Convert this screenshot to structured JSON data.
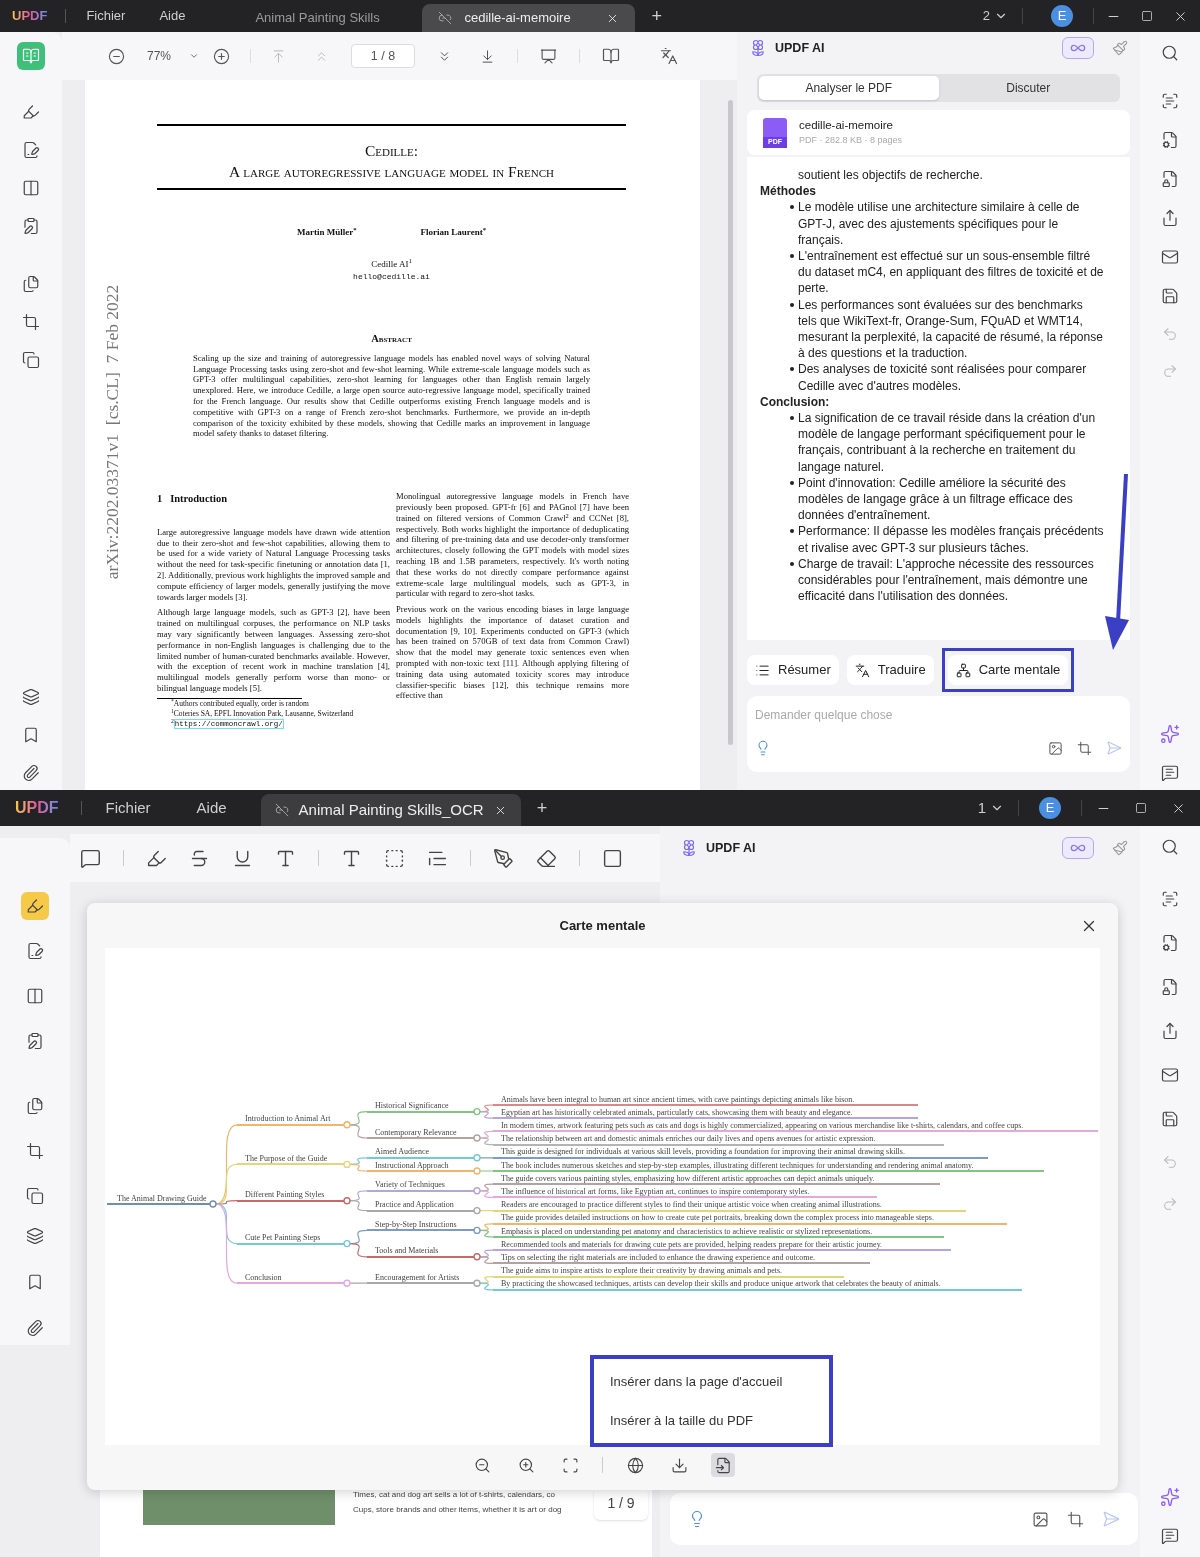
{
  "top_window": {
    "title_bar": {
      "logo": "UPDF",
      "menus": [
        "Fichier",
        "Aide"
      ],
      "tabs": [
        {
          "label": "Animal Painting Skills",
          "selected": false
        },
        {
          "label": "cedille-ai-memoire",
          "selected": true
        }
      ],
      "new_tab": "+",
      "window_count": "2",
      "avatar": "E"
    },
    "left_rail": [
      {
        "kind": "reader",
        "selected": true
      },
      {
        "kind": "comment",
        "selected": false
      },
      {
        "kind": "edit",
        "selected": false
      },
      {
        "kind": "pages",
        "selected": false
      },
      {
        "kind": "form",
        "selected": false
      },
      {
        "kind": "organize",
        "selected": false
      },
      {
        "kind": "crop",
        "selected": false
      },
      {
        "kind": "protect",
        "selected": false
      }
    ],
    "toolbar": {
      "zoom": "77%",
      "page": "1 / 8"
    },
    "pdf_page": {
      "side_label": "arXiv:2202.03371v1  [cs.CL]  7 Feb 2022",
      "title_lines": [
        "Cedille:",
        "A large autoregressive language model in French"
      ],
      "authors": [
        "Martin Müller$^{*}$",
        "Florian Laurent$^{*}$"
      ],
      "affiliation": "Cedille AI$^{1}$",
      "email": "hello@cedille.ai",
      "abstract_heading": "Abstract",
      "abstract": "Scaling up the size and training of autoregressive language models has enabled novel ways of solving Natural Language Processing tasks using zero-shot and few-shot learning. While extreme-scale language models such as GPT-3 offer multilingual capabilities, zero-shot learning for languages other than English remain largely unexplored. Here, we introduce Cedille, a large open source auto-regressive language model, specifically trained for the French language. Our results show that Cedille outperforms existing French language models and is competitive with GPT-3 on a range of French zero-shot benchmarks. Furthermore, we provide an in-depth comparison of the toxicity exhibited by these models, showing that Cedille marks an improvement in language model safety thanks to dataset filtering.",
      "section_number": "1",
      "section_title": "Introduction",
      "left_column": [
        "Large autoregressive language models have drawn wide attention due to their zero-shot and few-shot capabilities, allowing them to be used for a wide variety of Natural Language Processing tasks without the need for task-specific finetuning or annotation data [1, 2]. Additionally, previous work highlights the improved sample and compute efficiency of larger models, generally justifying the move towards larger models [3].",
        "Although large language models, such as GPT-3 [2], have been trained on multilingual corpuses, the performance on NLP tasks may vary significantly between languages. Assessing zero-shot performance in non-English languages is challenging due to the limited number of human-curated benchmarks available. However, with the exception of recent work in machine translation [4], multilingual models generally perform worse than mono- or bilingual language models [5]."
      ],
      "right_column": [
        "Monolingual autoregressive language models in French have previously been proposed. GPT-fr [6] and PAGnol [7] have been trained on filtered versions of Common Crawl$^{2}$ and CCNet [8], respectively. Both works highlight the importance of deduplicating and filtering of pre-training data and use decoder-only transformer architectures, closely following the GPT models with model sizes reaching 1B and 1.5B parameters, respectively. It's worth noting that these works do not directly compare performance against extreme-scale large multilingual models, such as GPT-3, in particular with regard to zero-shot tasks.",
        "Previous work on the various encoding biases in large language models highlights the importance of dataset curation and documentation [9, 10]. Experiments conducted on GPT-3 (which has been trained on 570GB of text data from Common Crawl) show that the model may generate toxic sentences even when prompted with non-toxic text [11]. Although applying filtering of training data using automated toxicity scores may introduce classifier-specific biases [12], this technique remains more effective than"
      ],
      "footnotes": [
        {
          "kind": "text",
          "text": "$^{*}$Authors contributed equally, order is random"
        },
        {
          "kind": "text",
          "text": "$^{1}$Coteries SA, EPFL Innovation Park, Lausanne, Switzerland"
        },
        {
          "kind": "link",
          "mark": "2",
          "text": "https://commoncrawl.org/"
        }
      ]
    },
    "ai_panel": {
      "title": "UPDF AI",
      "tabs": [
        {
          "label": "Analyser le PDF",
          "selected": true
        },
        {
          "label": "Discuter",
          "selected": false
        }
      ],
      "file": {
        "name": "cedille-ai-memoire",
        "meta": "PDF · 282.8 KB · 8 pages",
        "badge": "PDF"
      },
      "content": [
        {
          "kind": "text",
          "text": "soutient les objectifs de recherche."
        },
        {
          "kind": "heading",
          "text": "Méthodes"
        },
        {
          "kind": "bullet",
          "text": "Le modèle utilise une architecture similaire à celle de GPT-J, avec des ajustements spécifiques pour le français."
        },
        {
          "kind": "bullet",
          "text": "L'entraînement est effectué sur un sous-ensemble filtré du dataset mC4, en appliquant des filtres de toxicité et de perte."
        },
        {
          "kind": "bullet",
          "text": "Les performances sont évaluées sur des benchmarks tels que WikiText-fr, Orange-Sum, FQuAD et WMT14, mesurant la perplexité, la capacité de résumé, la réponse à des questions et la traduction."
        },
        {
          "kind": "bullet",
          "text": "Des analyses de toxicité sont réalisées pour comparer Cedille avec d'autres modèles."
        },
        {
          "kind": "heading",
          "text": "Conclusion:"
        },
        {
          "kind": "bullet",
          "text": "La signification de ce travail réside dans la création d'un modèle de langage performant spécifiquement pour le français, contribuant à la recherche en traitement du langage naturel."
        },
        {
          "kind": "bullet",
          "text": "Point d'innovation: Cedille améliore la sécurité des modèles de langage grâce à un filtrage efficace des données d'entraînement."
        },
        {
          "kind": "bullet",
          "text": "Performance: Il dépasse les modèles français précédents et rivalise avec GPT-3 sur plusieurs tâches."
        },
        {
          "kind": "bullet",
          "text": "Charge de travail: L'approche nécessite des ressources considérables pour l'entraînement, mais démontre une efficacité dans l'utilisation des données."
        }
      ],
      "actions": [
        {
          "kind": "summary",
          "label": "Résumer",
          "highlighted": false
        },
        {
          "kind": "translate",
          "label": "Traduire",
          "highlighted": false
        },
        {
          "kind": "mindmap",
          "label": "Carte mentale",
          "highlighted": true
        }
      ],
      "input": {
        "placeholder": "Demander quelque chose"
      }
    }
  },
  "bottom_window": {
    "title_bar": {
      "logo": "UPDF",
      "menus": [
        "Fichier",
        "Aide"
      ],
      "tabs": [
        {
          "label": "Animal Painting Skills_OCR",
          "selected": true
        }
      ],
      "new_tab": "+",
      "window_count": "1",
      "avatar": "E"
    },
    "left_rail": [
      {
        "kind": "comment",
        "selected": true
      },
      {
        "kind": "edit",
        "selected": false
      },
      {
        "kind": "pages",
        "selected": false
      },
      {
        "kind": "form",
        "selected": false
      },
      {
        "kind": "organize",
        "selected": false
      },
      {
        "kind": "crop",
        "selected": false
      },
      {
        "kind": "protect",
        "selected": false
      }
    ],
    "ai_panel": {
      "title": "UPDF AI"
    },
    "page": {
      "lines": [
        "Times, cat and dog art sells a lot of t-shirts, calendars, co",
        "Cups, store brands and other items, whether it is art or dog"
      ],
      "page_indicator": "1 / 9"
    },
    "mind_map_dialog": {
      "title": "Carte mentale",
      "root": {
        "label": "The Animal Drawing Guide",
        "color": "#6f8fb0",
        "children": [
          {
            "label": "Introduction to Animal Art",
            "color": "#f0b56a",
            "children": [
              {
                "label": "Historical Significance",
                "color": "#82c482",
                "children": [
                  {
                    "label": "Animals have been integral to human art since ancient times, with cave paintings depicting animals like bison.",
                    "color": "#d48a8a"
                  },
                  {
                    "label": "Egyptian art has historically celebrated animals, particularly cats, showcasing them with beauty and elegance.",
                    "color": "#b5a5dc"
                  }
                ]
              },
              {
                "label": "Contemporary Relevance",
                "color": "#b7a0a0",
                "children": [
                  {
                    "label": "In modern times, artwork featuring pets such as cats and dogs is highly commercialized, appearing on various merchandise like t-shirts, calendars, and coffee cups.",
                    "color": "#e2a8e2"
                  },
                  {
                    "label": "The relationship between art and domestic animals enriches our daily lives and opens avenues for artistic expression.",
                    "color": "#b4b4b4"
                  }
                ]
              }
            ]
          },
          {
            "label": "The Purpose of the Guide",
            "color": "#e2d678",
            "children": [
              {
                "label": "Aimed Audience",
                "color": "#74c8da",
                "children": [
                  {
                    "label": "This guide is designed for individuals at various skill levels, providing a foundation for improving their animal drawing skills.",
                    "color": "#7c9cc8"
                  }
                ]
              },
              {
                "label": "Instructional Approach",
                "color": "#f0b56a",
                "children": [
                  {
                    "label": "The book includes numerous sketches and step-by-step examples, illustrating different techniques for understanding and rendering animal anatomy.",
                    "color": "#82c482"
                  }
                ]
              }
            ]
          },
          {
            "label": "Different Painting Styles",
            "color": "#c46a6a",
            "children": [
              {
                "label": "Variety of Techniques",
                "color": "#b5a5dc",
                "children": [
                  {
                    "label": "The guide covers various painting styles, emphasizing how different artistic approaches can depict animals uniquely.",
                    "color": "#b7a0a0"
                  },
                  {
                    "label": "The influence of historical art forms, like Egyptian art, continues to inspire contemporary styles.",
                    "color": "#e2a8e2"
                  }
                ]
              },
              {
                "label": "Practice and Application",
                "color": "#a8a8a8",
                "children": [
                  {
                    "label": "Readers are encouraged to practice different styles to find their unique artistic voice when creating animal illustrations.",
                    "color": "#e2d678"
                  }
                ]
              }
            ]
          },
          {
            "label": "Cute Pet Painting Steps",
            "color": "#74c8da",
            "children": [
              {
                "label": "Step-by-Step Instructions",
                "color": "#7c9cc8",
                "children": [
                  {
                    "label": "The guide provides detailed instructions on how to create cute pet portraits, breaking down the complex process into manageable steps.",
                    "color": "#f0b56a"
                  },
                  {
                    "label": "Emphasis is placed on understanding pet anatomy and characteristics to achieve realistic or stylized representations.",
                    "color": "#82c482"
                  }
                ]
              },
              {
                "label": "Tools and Materials",
                "color": "#c46a6a",
                "children": [
                  {
                    "label": "Recommended tools and materials for drawing cute pets are provided, helping readers prepare for their artistic journey.",
                    "color": "#b5a5dc"
                  },
                  {
                    "label": "Tips on selecting the right materials are included to enhance the drawing experience and outcome.",
                    "color": "#b7a0a0"
                  }
                ]
              }
            ]
          },
          {
            "label": "Conclusion",
            "color": "#e2a8e2",
            "children": [
              {
                "label": "Encouragement for Artists",
                "color": "#a8a8a8",
                "children": [
                  {
                    "label": "The guide aims to inspire artists to explore their creativity by drawing animals and pets.",
                    "color": "#e2d678"
                  },
                  {
                    "label": "By practicing the showcased techniques, artists can develop their skills and produce unique artwork that celebrates the beauty of animals.",
                    "color": "#74c8da"
                  }
                ]
              }
            ]
          }
        ]
      },
      "insert_menu": [
        "Insérer dans la page d'accueil",
        "Insérer à la taille du PDF"
      ],
      "tools": [
        {
          "kind": "zoom_out",
          "selected": false
        },
        {
          "kind": "zoom_in",
          "selected": false
        },
        {
          "kind": "fit",
          "selected": false
        },
        {
          "kind": "globe",
          "selected": false
        },
        {
          "kind": "download",
          "selected": false
        },
        {
          "kind": "insert",
          "selected": true
        }
      ]
    }
  }
}
